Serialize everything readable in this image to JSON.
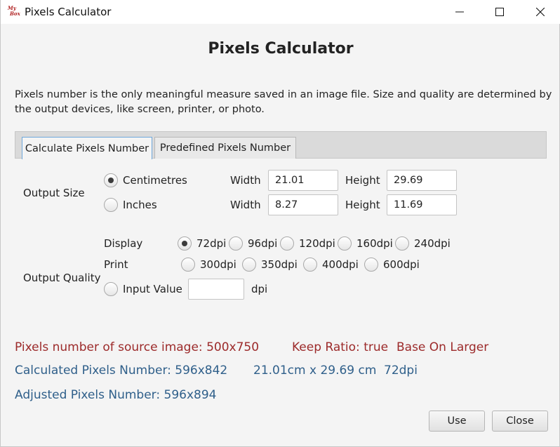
{
  "window": {
    "title": "Pixels Calculator",
    "icon_text_top": "My",
    "icon_text_bottom": "Box"
  },
  "dialog": {
    "heading": "Pixels Calculator",
    "description_line1": "Pixels number is the only meaningful measure saved in an image file. Size and quality are determined by",
    "description_line2": "the output devices, like screen, printer, or photo."
  },
  "tabs": [
    {
      "label": "Calculate Pixels Number",
      "active": true
    },
    {
      "label": "Predefined Pixels Number",
      "active": false
    }
  ],
  "output_size": {
    "label": "Output Size",
    "rows": [
      {
        "unit": "Centimetres",
        "selected": true,
        "width_label": "Width",
        "width": "21.01",
        "height_label": "Height",
        "height": "29.69"
      },
      {
        "unit": "Inches",
        "selected": false,
        "width_label": "Width",
        "width": "8.27",
        "height_label": "Height",
        "height": "11.69"
      }
    ]
  },
  "output_quality": {
    "label": "Output Quality",
    "display_label": "Display",
    "display_options": [
      {
        "label": "72dpi",
        "selected": true
      },
      {
        "label": "96dpi",
        "selected": false
      },
      {
        "label": "120dpi",
        "selected": false
      },
      {
        "label": "160dpi",
        "selected": false
      },
      {
        "label": "240dpi",
        "selected": false
      }
    ],
    "print_label": "Print",
    "print_options": [
      {
        "label": "300dpi",
        "selected": false
      },
      {
        "label": "350dpi",
        "selected": false
      },
      {
        "label": "400dpi",
        "selected": false
      },
      {
        "label": "600dpi",
        "selected": false
      }
    ],
    "input_value_label": "Input Value",
    "input_value": "",
    "input_unit": "dpi"
  },
  "info": {
    "source_pixels": "Pixels number of source image: 500x750",
    "keep_ratio": "Keep Ratio: true",
    "base_on": "Base On Larger",
    "calculated": "Calculated Pixels Number: 596x842",
    "calculated_size": "21.01cm x 29.69 cm",
    "calculated_dpi": "72dpi",
    "adjusted": "Adjusted Pixels Number: 596x894"
  },
  "buttons": {
    "use": "Use",
    "close": "Close"
  },
  "colors": {
    "info_red": "#9c2a2a",
    "info_blue": "#2f5f8a",
    "active_tab_border": "#6fa8dc"
  }
}
